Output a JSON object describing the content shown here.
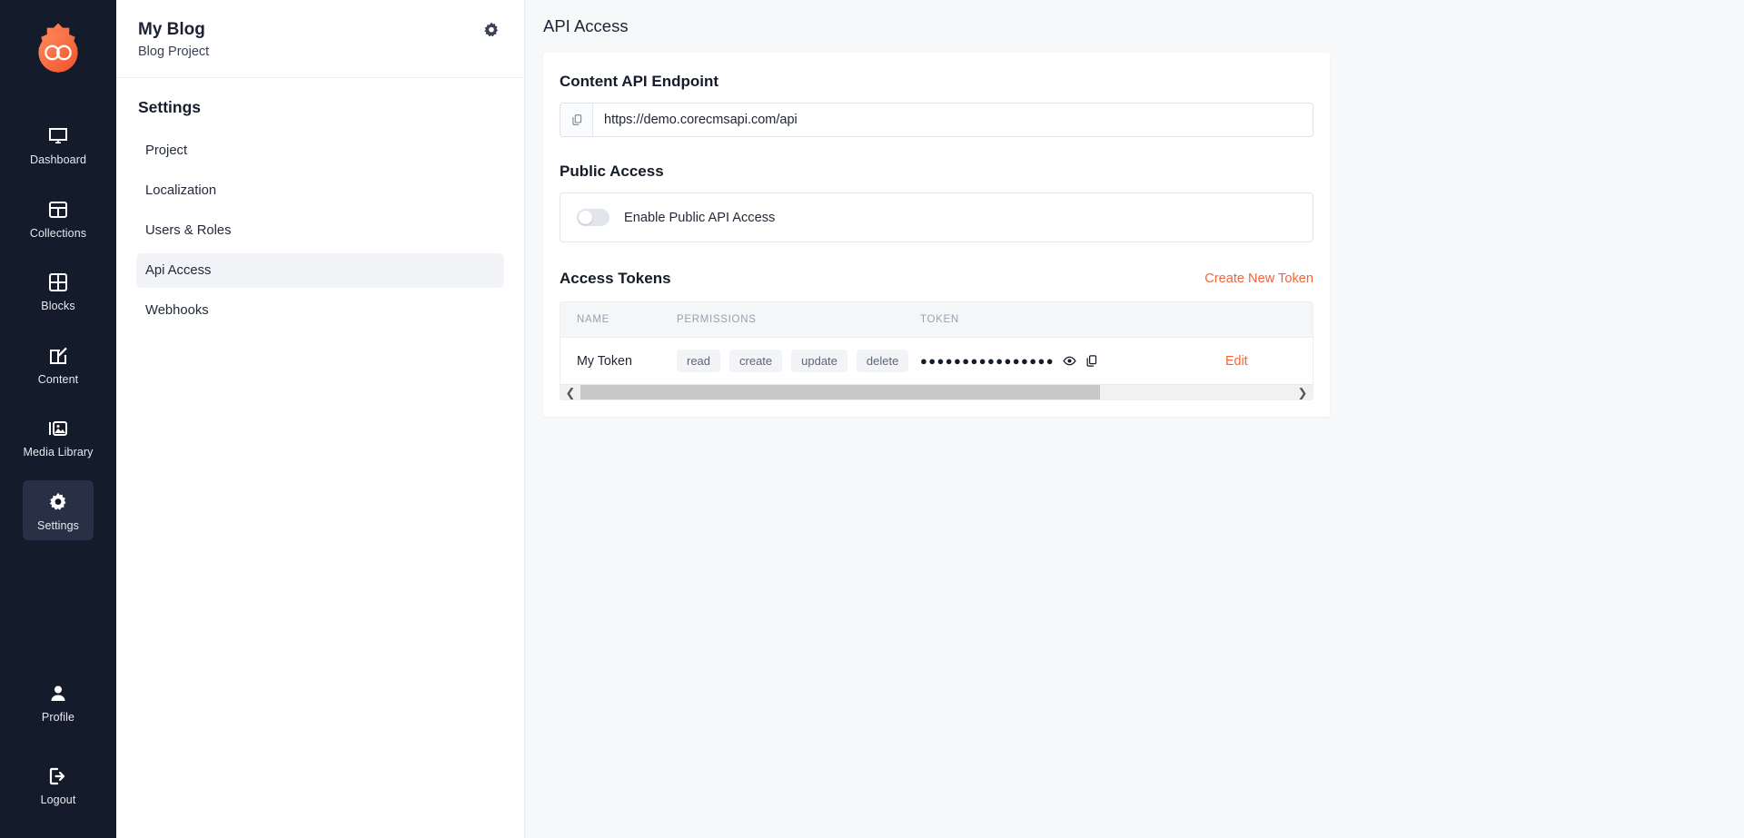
{
  "rail": {
    "logo_name": "infinity-gear-logo",
    "items": [
      {
        "label": "Dashboard",
        "icon": "monitor-icon",
        "active": false
      },
      {
        "label": "Collections",
        "icon": "table-icon",
        "active": false
      },
      {
        "label": "Blocks",
        "icon": "grid-icon",
        "active": false
      },
      {
        "label": "Content",
        "icon": "edit-square-icon",
        "active": false
      },
      {
        "label": "Media Library",
        "icon": "image-icon",
        "active": false
      },
      {
        "label": "Settings",
        "icon": "gear-icon",
        "active": true
      }
    ],
    "bottom_items": [
      {
        "label": "Profile",
        "icon": "user-icon"
      },
      {
        "label": "Logout",
        "icon": "logout-icon"
      }
    ]
  },
  "sidebar": {
    "project_name": "My Blog",
    "project_subtitle": "Blog Project",
    "gear_icon": "gear-icon",
    "section_title": "Settings",
    "nav": [
      {
        "label": "Project",
        "active": false
      },
      {
        "label": "Localization",
        "active": false
      },
      {
        "label": "Users & Roles",
        "active": false
      },
      {
        "label": "Api Access",
        "active": true
      },
      {
        "label": "Webhooks",
        "active": false
      }
    ]
  },
  "main": {
    "page_title": "API Access",
    "endpoint": {
      "title": "Content API Endpoint",
      "copy_icon": "copy-icon",
      "value": "https://demo.corecmsapi.com/api"
    },
    "public_access": {
      "title": "Public Access",
      "toggle_label": "Enable Public API Access",
      "toggle_state": "off"
    },
    "tokens": {
      "title": "Access Tokens",
      "create_label": "Create New Token",
      "columns": [
        "NAME",
        "PERMISSIONS",
        "TOKEN",
        ""
      ],
      "rows": [
        {
          "name": "My Token",
          "permissions": [
            "read",
            "create",
            "update",
            "delete"
          ],
          "token_masked": "●●●●●●●●●●●●●●●●",
          "reveal_icon": "eye-icon",
          "copy_icon": "copy-icon",
          "action_label": "Edit"
        }
      ],
      "scroll_left_icon": "chevron-left-icon",
      "scroll_right_icon": "chevron-right-icon"
    }
  },
  "colors": {
    "accent": "#f2653a",
    "rail_bg": "#141b2b",
    "rail_active": "#283045",
    "page_bg": "#f7f8fa",
    "card_bg": "#ffffff",
    "pill_bg": "#f2f4f7",
    "muted_text": "#9aa1ad"
  }
}
